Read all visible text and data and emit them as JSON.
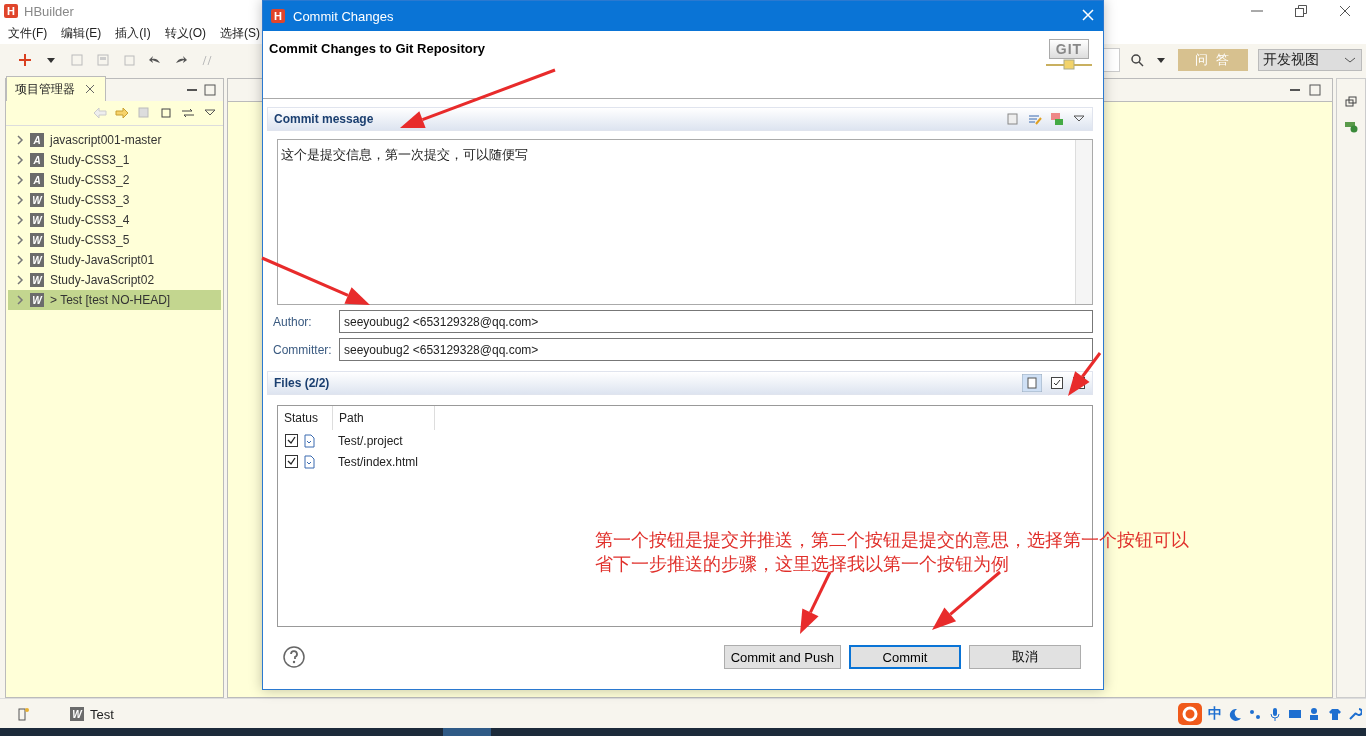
{
  "app": {
    "logo": "H",
    "title": "HBuilder"
  },
  "menu": [
    "文件(F)",
    "编辑(E)",
    "插入(I)",
    "转义(O)",
    "选择(S)"
  ],
  "toolbar": {
    "qa_button": "问 答",
    "perspective": "开发视图"
  },
  "project_panel": {
    "tab": "项目管理器",
    "items": [
      {
        "label": "javascript001-master",
        "badge": "A",
        "selected": false
      },
      {
        "label": "Study-CSS3_1",
        "badge": "A",
        "selected": false
      },
      {
        "label": "Study-CSS3_2",
        "badge": "A",
        "selected": false
      },
      {
        "label": "Study-CSS3_3",
        "badge": "W",
        "selected": false
      },
      {
        "label": "Study-CSS3_4",
        "badge": "W",
        "selected": false
      },
      {
        "label": "Study-CSS3_5",
        "badge": "W",
        "selected": false
      },
      {
        "label": "Study-JavaScript01",
        "badge": "W",
        "selected": false
      },
      {
        "label": "Study-JavaScript02",
        "badge": "W",
        "selected": false
      },
      {
        "label": "> Test [test NO-HEAD]",
        "badge": "W",
        "selected": true
      }
    ]
  },
  "dialog": {
    "logo": "H",
    "title": "Commit Changes",
    "heading": "Commit Changes to Git Repository",
    "git_logo": "GIT",
    "message_section": "Commit message",
    "message": "这个是提交信息，第一次提交，可以随便写",
    "author_label": "Author:",
    "author": "seeyoubug2 <653129328@qq.com>",
    "committer_label": "Committer:",
    "committer": "seeyoubug2 <653129328@qq.com>",
    "files_section": "Files (2/2)",
    "files": {
      "columns": [
        "Status",
        "Path"
      ],
      "rows": [
        {
          "checked": true,
          "path": "Test/.project"
        },
        {
          "checked": true,
          "path": "Test/index.html"
        }
      ]
    },
    "buttons": [
      {
        "label": "Commit and Push",
        "default": false
      },
      {
        "label": "Commit",
        "default": true
      },
      {
        "label": "取消",
        "default": false
      }
    ]
  },
  "annotation": "第一个按钮是提交并推送，第二个按钮是提交的意思，选择第一个按钮可以省下一步推送的步骤，这里选择我以第一个按钮为例",
  "status_bar": {
    "badge": "W",
    "project": "Test",
    "ime": "中"
  }
}
